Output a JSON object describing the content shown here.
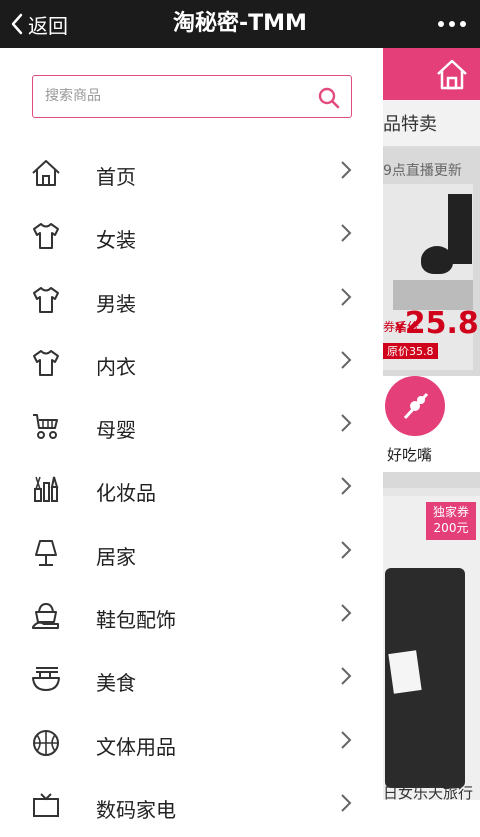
{
  "header": {
    "back_label": "返回",
    "title": "淘秘密-TMM"
  },
  "search": {
    "placeholder": "搜索商品"
  },
  "menu": {
    "items": [
      {
        "label": "首页",
        "icon": "home-icon"
      },
      {
        "label": "女装",
        "icon": "shirt-icon"
      },
      {
        "label": "男装",
        "icon": "shirt-icon"
      },
      {
        "label": "内衣",
        "icon": "shirt-icon"
      },
      {
        "label": "母婴",
        "icon": "stroller-icon"
      },
      {
        "label": "化妆品",
        "icon": "cosmetics-icon"
      },
      {
        "label": "居家",
        "icon": "lamp-icon"
      },
      {
        "label": "鞋包配饰",
        "icon": "shoe-bag-icon"
      },
      {
        "label": "美食",
        "icon": "bowl-icon"
      },
      {
        "label": "文体用品",
        "icon": "ball-icon"
      },
      {
        "label": "数码家电",
        "icon": "tv-icon"
      }
    ]
  },
  "background_page": {
    "section_title": "品特卖",
    "live_note": "9点直播更新",
    "price_label": "券后价",
    "price_currency": "¥",
    "price": "25.8",
    "original_price": "原价35.8",
    "snack_label": "好吃嘴",
    "coupon_line1": "独家券",
    "coupon_line2": "200元",
    "caption": "日女乐天旅行"
  },
  "colors": {
    "accent": "#e53f79",
    "topbar": "#1b1b1b"
  }
}
